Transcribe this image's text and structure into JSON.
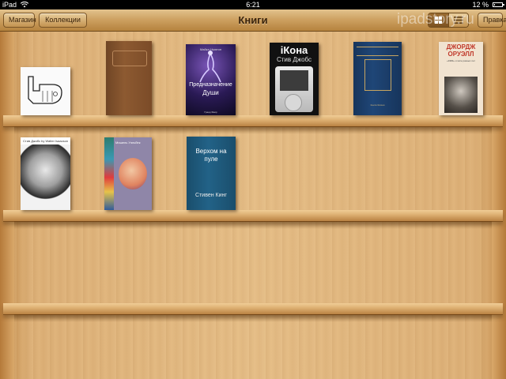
{
  "status": {
    "carrier": "iPad",
    "time": "6:21",
    "battery_pct": "12 %",
    "battery_level": 0.12
  },
  "navbar": {
    "store_label": "Магазин",
    "collections_label": "Коллекции",
    "title": "Книги",
    "edit_label": "Правка",
    "watermark": "ipadstory.ru"
  },
  "books": [
    {
      "id": "thumbs-book",
      "cover": "drawing-of-thumbs-up-hand"
    },
    {
      "id": "signature-book",
      "cover": "brown-leather-with-signature"
    },
    {
      "id": "soul-purpose",
      "author": "Майкл Ньютон",
      "title_line1": "Предназначение",
      "title_line2": "Души",
      "publisher": "Гранд Фаир"
    },
    {
      "id": "icon-jobs",
      "title": "iКона",
      "author": "Стив Джобс"
    },
    {
      "id": "blue-classic",
      "publisher": "Книга Жизни"
    },
    {
      "id": "orwell",
      "title": "ДЖОРДЖ ОРУЭЛЛ",
      "subtitle": "«1984» и эссе разных лет"
    },
    {
      "id": "steve-jobs-isaacson",
      "header": "Стив Джобс by Walter Isaacson"
    },
    {
      "id": "houellebecq",
      "name": "Мишель Уэльбек"
    },
    {
      "id": "stephen-king",
      "title_line1": "Верхом на",
      "title_line2": "пуле",
      "author": "Стивен Кинг"
    }
  ],
  "colors": {
    "nav_text": "#3a230b",
    "wood_light": "#e5bd86",
    "wood_dark": "#b98142"
  }
}
